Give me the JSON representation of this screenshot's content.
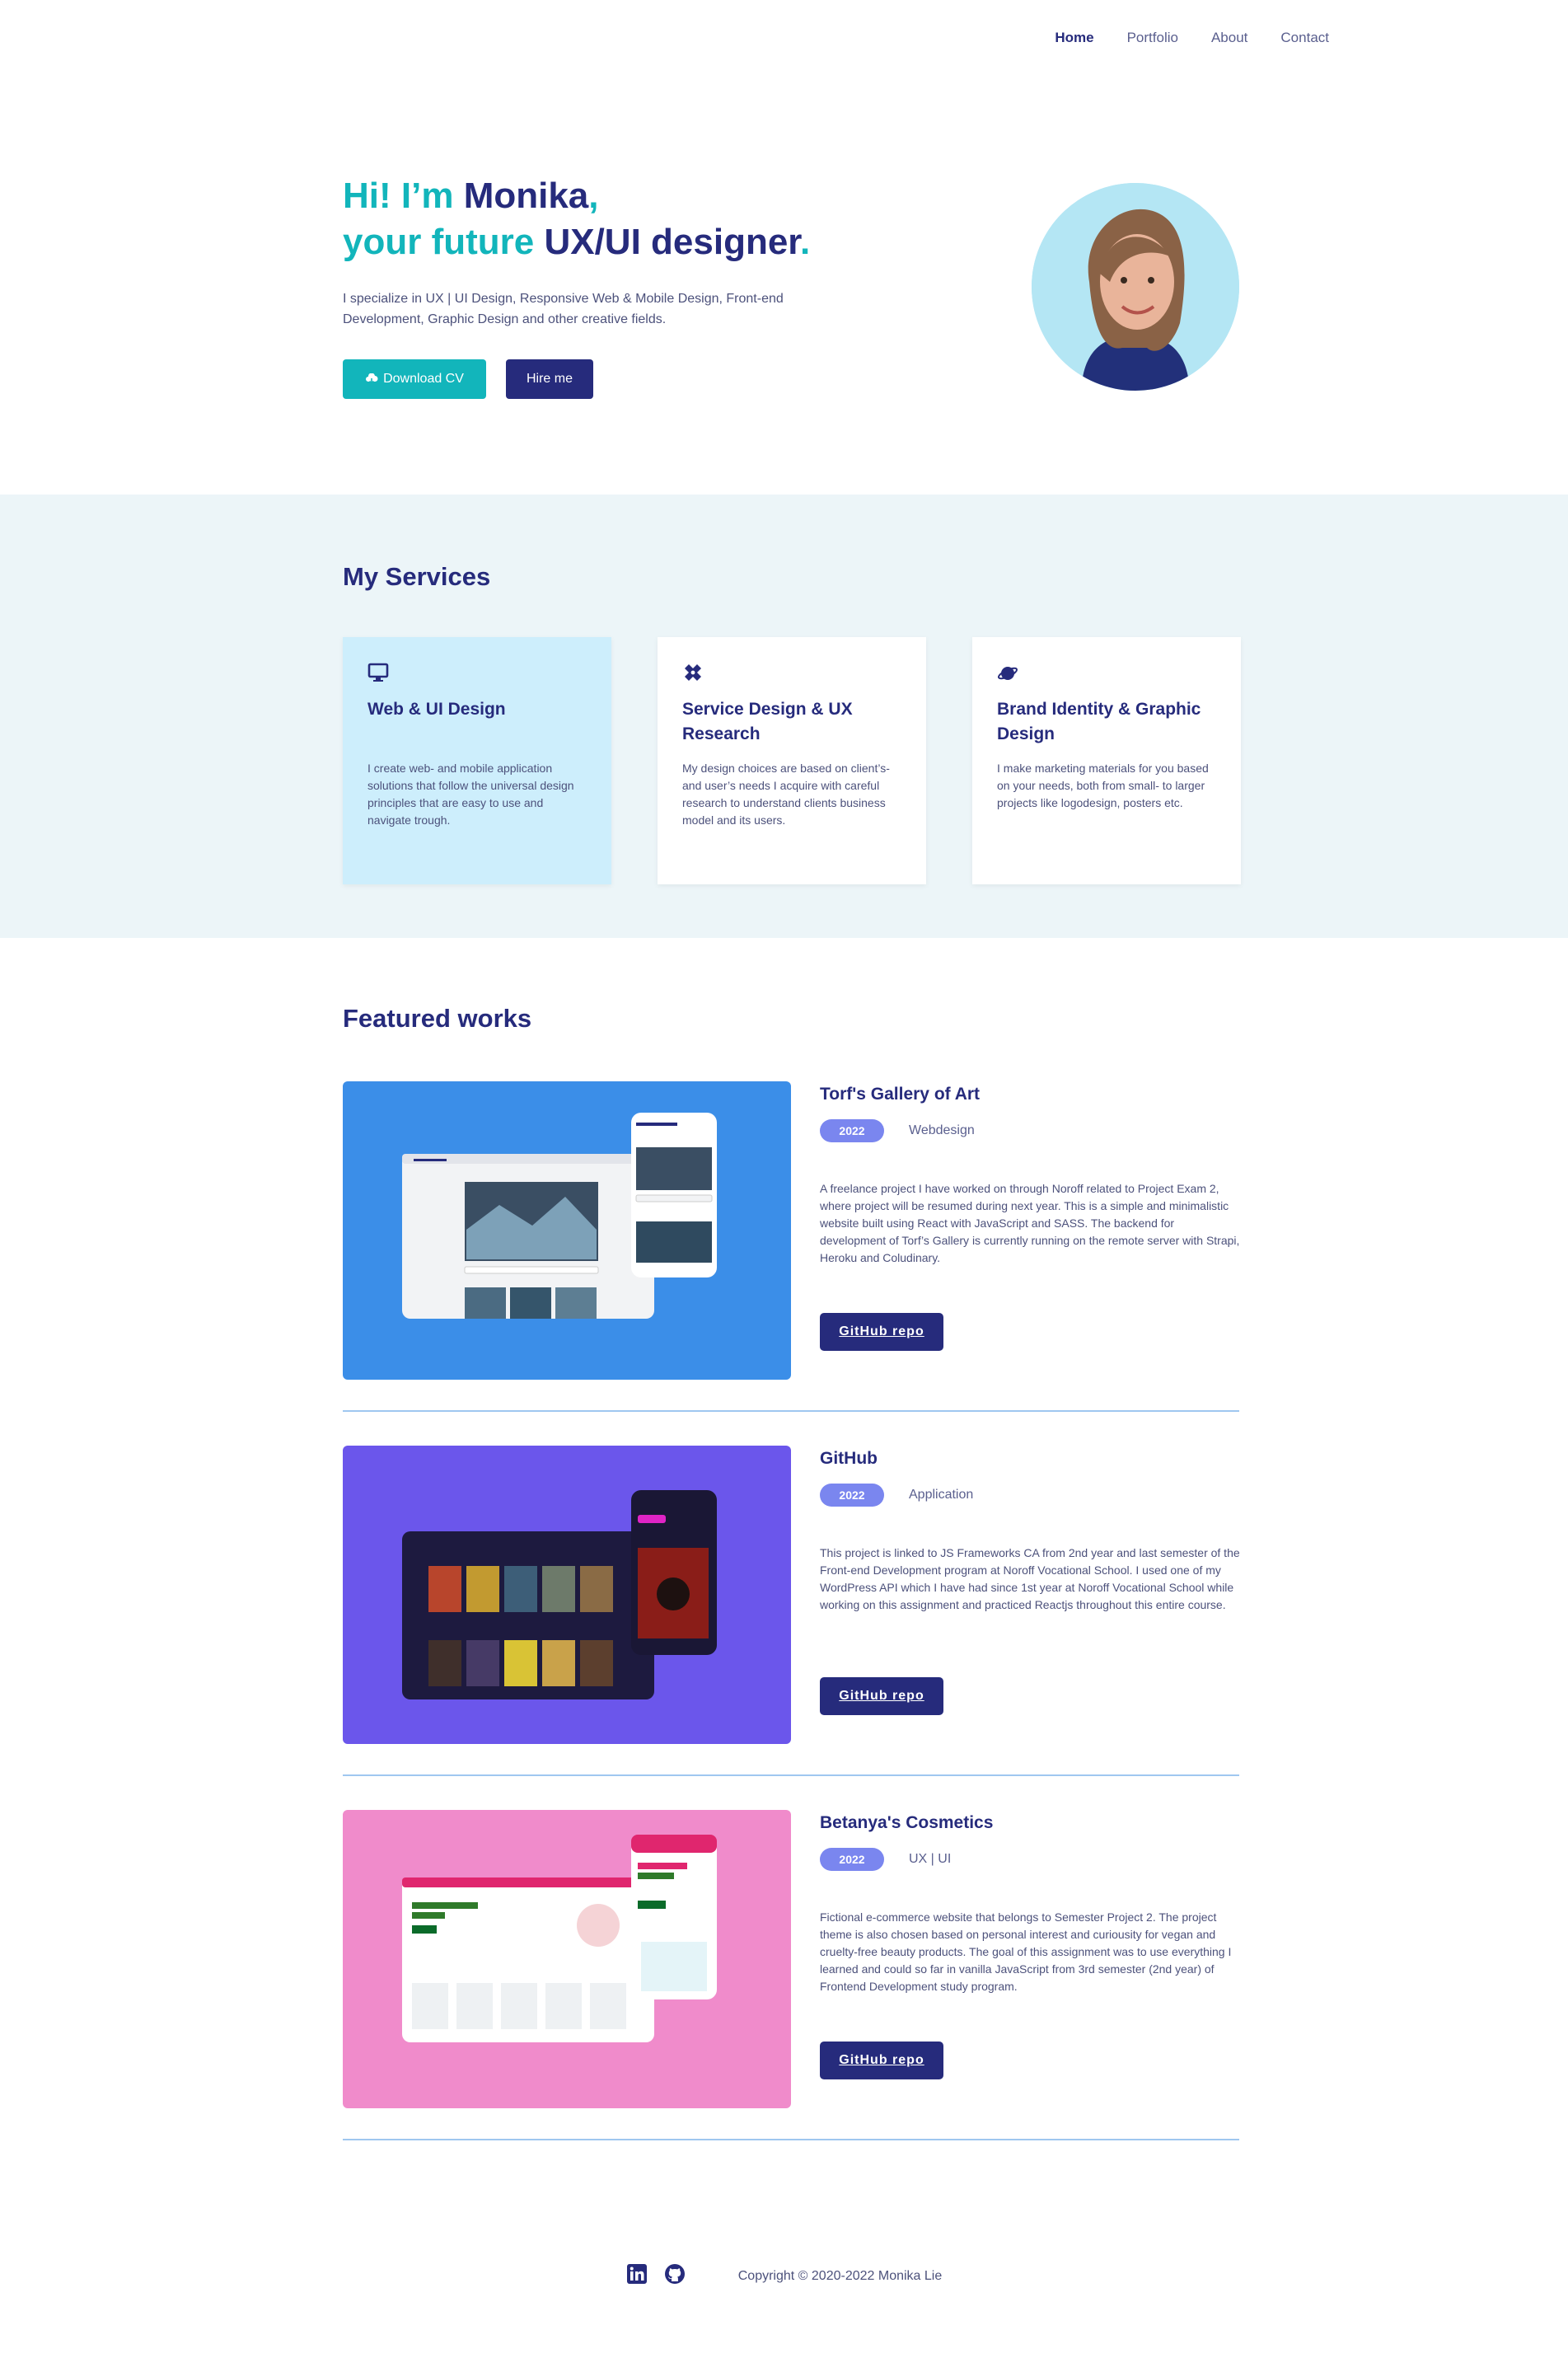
{
  "nav": {
    "items": [
      "Home",
      "Portfolio",
      "About",
      "Contact"
    ],
    "active": "Home"
  },
  "hero": {
    "line1_hi": "Hi! I’m ",
    "line1_name": "Monika",
    "line1_comma": ",",
    "line2_pre": "your future ",
    "line2_role": "UX/UI designer",
    "line2_dot": ".",
    "description": "I specialize in UX | UI Design, Responsive Web & Mobile Design, Front-end Development, Graphic Design and other creative fields.",
    "download_label": "Download CV",
    "hire_label": "Hire me"
  },
  "services": {
    "title": "My Services",
    "cards": [
      {
        "icon": "monitor-icon",
        "title": "Web & UI Design",
        "text": "I create web- and mobile application solutions that follow the universal design principles that are easy to use and navigate trough."
      },
      {
        "icon": "tools-icon",
        "title": "Service Design & UX Research",
        "text": "My design choices are based on client’s- and user’s needs I acquire with careful research to understand clients business model and its users."
      },
      {
        "icon": "planet-icon",
        "title": "Brand Identity & Graphic Design",
        "text": "I make marketing materials for you based on your needs, both from small- to larger projects like logodesign, posters etc."
      }
    ]
  },
  "featured": {
    "title": "Featured works",
    "works": [
      {
        "title": "Torf's Gallery of Art",
        "year": "2022",
        "category": "Webdesign",
        "bg": "#3b8ee8",
        "description": "A freelance project I have worked on through Noroff related to Project Exam 2, where project will be resumed during next year. This is a simple and minimalistic website built using React with JavaScript and SASS. The backend for development of Torf’s Gallery is currently running on the remote server with Strapi, Heroku and Coludinary.",
        "button": "GitHub repo"
      },
      {
        "title": "GitHub",
        "year": "2022",
        "category": "Application",
        "bg": "#6b56eb",
        "description": "This project is linked to JS Frameworks CA from 2nd year and last semester of the Front-end Development program at Noroff Vocational School. I used one of my WordPress API which I have had since 1st year at Noroff Vocational School while working on this assignment and practiced Reactjs throughout this entire course.",
        "button": "GitHub repo"
      },
      {
        "title": "Betanya's Cosmetics",
        "year": "2022",
        "category": "UX | UI",
        "bg": "#f08bcb",
        "description": "Fictional e-commerce website that belongs to Semester Project 2. The project theme is also chosen based on personal interest and curiousity for vegan and cruelty-free beauty products. The goal of this assignment was to use everything I learned and could so far in vanilla JavaScript from 3rd semester (2nd year) of Frontend Development study program.",
        "button": "GitHub repo"
      }
    ]
  },
  "footer": {
    "copyright": "Copyright © 2020-2022 Monika Lie"
  }
}
